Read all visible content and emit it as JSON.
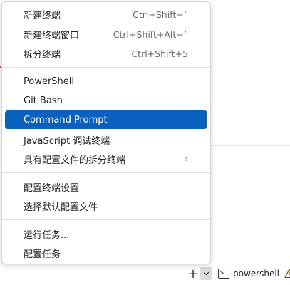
{
  "menu": {
    "groups": [
      {
        "items": [
          {
            "label": "新建终端",
            "shortcut": "Ctrl+Shift+`"
          },
          {
            "label": "新建终端窗口",
            "shortcut": "Ctrl+Shift+Alt+`"
          },
          {
            "label": "拆分终端",
            "shortcut": "Ctrl+Shift+5"
          }
        ]
      },
      {
        "items": [
          {
            "label": "PowerShell"
          },
          {
            "label": "Git Bash"
          },
          {
            "label": "Command Prompt",
            "highlighted": true
          },
          {
            "label": "JavaScript 调试终端"
          },
          {
            "label": "具有配置文件的拆分终端",
            "submenu_glyph": "›"
          }
        ]
      },
      {
        "items": [
          {
            "label": "配置终端设置"
          },
          {
            "label": "选择默认配置文件"
          }
        ]
      },
      {
        "items": [
          {
            "label": "运行任务..."
          },
          {
            "label": "配置任务"
          }
        ]
      }
    ]
  },
  "statusbar": {
    "add_glyph": "+",
    "dropdown_glyph": "⌄",
    "terminal_icon_glyph": ">_",
    "terminal_name": "powershell"
  },
  "colors": {
    "highlight": "#0960be",
    "warning": "#bf8803"
  }
}
